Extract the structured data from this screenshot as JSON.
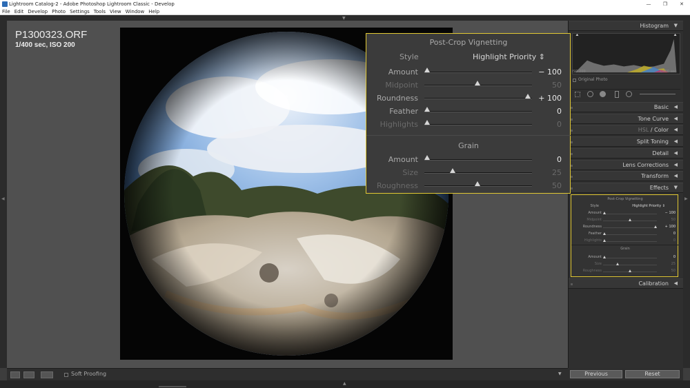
{
  "window": {
    "title": "Lightroom Catalog-2 - Adobe Photoshop Lightroom Classic - Develop",
    "minimize": "—",
    "maximize": "❐",
    "close": "✕"
  },
  "menu": [
    "File",
    "Edit",
    "Develop",
    "Photo",
    "Settings",
    "Tools",
    "View",
    "Window",
    "Help"
  ],
  "photo": {
    "filename": "P1300323.ORF",
    "info": "1/400 sec, ISO 200"
  },
  "toolbar": {
    "soft_proofing": "Soft Proofing"
  },
  "right_panel": {
    "histogram_label": "Histogram",
    "histogram_iso": "ISO 200",
    "histogram_exposure": "1/400 sec",
    "original_photo": "Original Photo",
    "sections": [
      "Basic",
      "Tone Curve",
      "HSL / Color",
      "Split Toning",
      "Detail",
      "Lens Corrections",
      "Transform",
      "Effects",
      "Calibration"
    ],
    "hsl_parts": [
      "HSL",
      " / ",
      "Color"
    ]
  },
  "effects": {
    "vignette_title": "Post-Crop Vignetting",
    "style_label": "Style",
    "style_value": "Highlight Priority",
    "style_arrows": "⇕",
    "vignette": [
      {
        "label": "Amount",
        "value": "− 100",
        "pos": 0.0,
        "dim": false
      },
      {
        "label": "Midpoint",
        "value": "50",
        "pos": 0.5,
        "dim": true
      },
      {
        "label": "Roundness",
        "value": "+ 100",
        "pos": 1.0,
        "dim": false
      },
      {
        "label": "Feather",
        "value": "0",
        "pos": 0.0,
        "dim": false
      },
      {
        "label": "Highlights",
        "value": "0",
        "pos": 0.0,
        "dim": true
      }
    ],
    "grain_title": "Grain",
    "grain": [
      {
        "label": "Amount",
        "value": "0",
        "pos": 0.0,
        "dim": false
      },
      {
        "label": "Size",
        "value": "25",
        "pos": 0.25,
        "dim": true
      },
      {
        "label": "Roughness",
        "value": "50",
        "pos": 0.5,
        "dim": true
      }
    ]
  },
  "buttons": {
    "previous": "Previous",
    "reset": "Reset"
  },
  "colors": {
    "highlight": "#e2c933",
    "panel": "#2f2f2f",
    "workspace": "#505050"
  },
  "icons": {
    "collapse_top": "triangle-down-icon",
    "collapse_left": "triangle-left-icon",
    "collapse_right": "triangle-right-icon",
    "collapse_bottom": "triangle-up-icon",
    "panel_arrow": "triangle-left-icon",
    "panel_open_arrow": "triangle-down-icon"
  }
}
